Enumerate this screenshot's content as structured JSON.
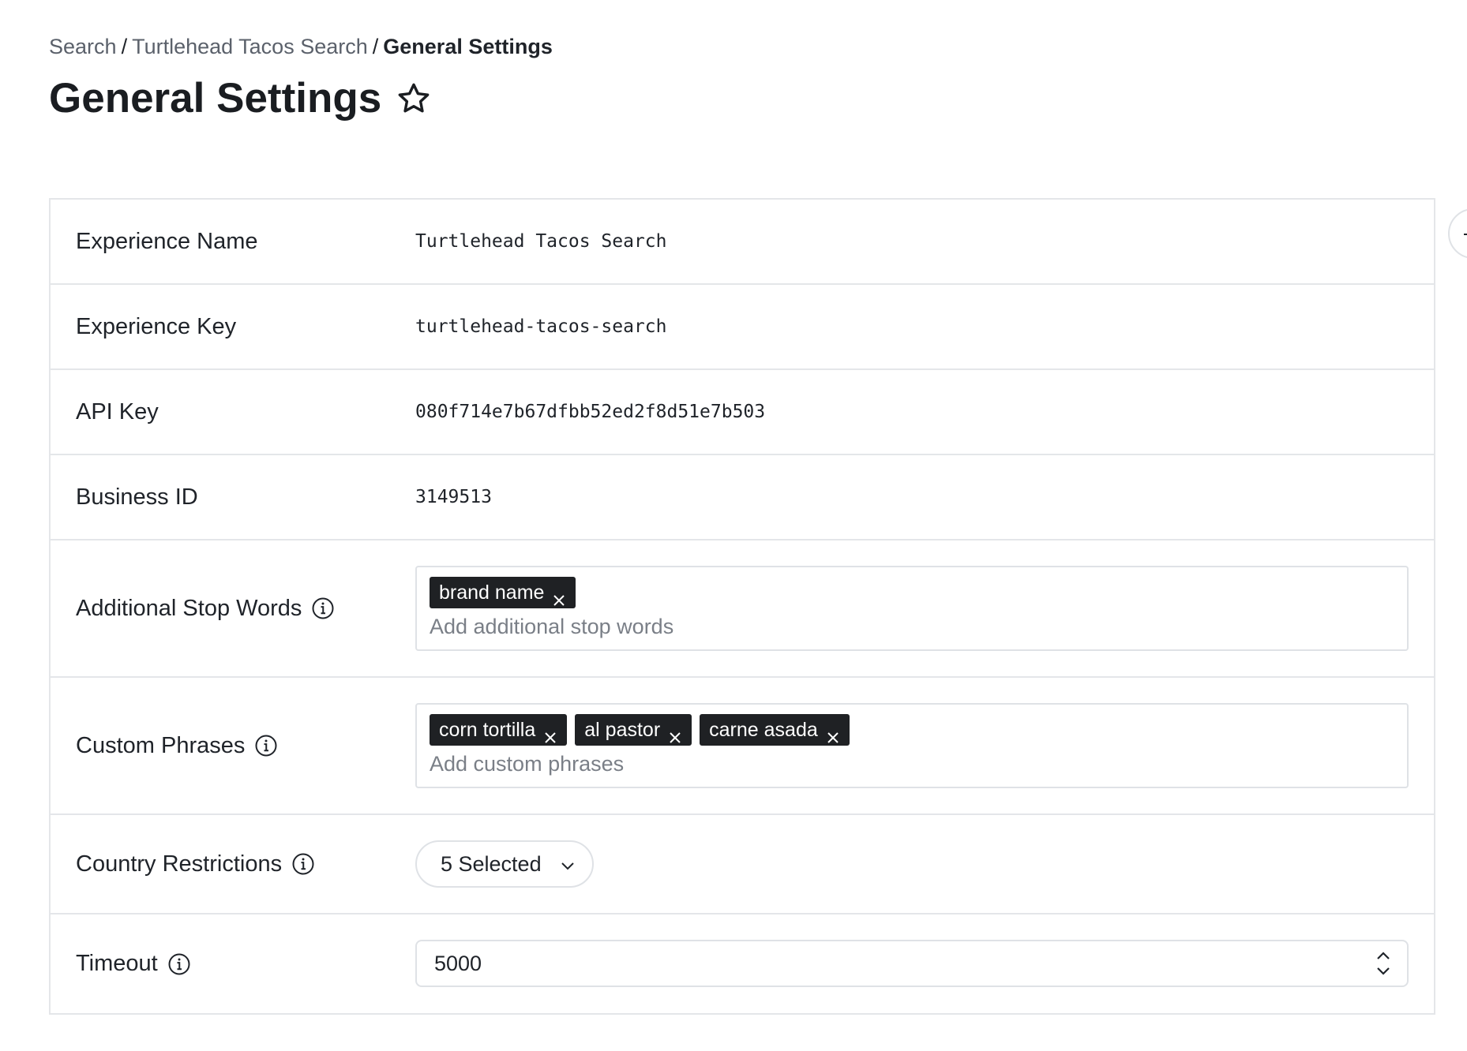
{
  "breadcrumb": {
    "items": [
      "Search",
      "Turtlehead Tacos Search"
    ],
    "current": "General Settings",
    "separator": "/"
  },
  "page": {
    "title": "General Settings",
    "favorite_icon": "star-icon"
  },
  "settings": {
    "experience_name": {
      "label": "Experience Name",
      "value": "Turtlehead Tacos Search"
    },
    "experience_key": {
      "label": "Experience Key",
      "value": "turtlehead-tacos-search"
    },
    "api_key": {
      "label": "API Key",
      "value": "080f714e7b67dfbb52ed2f8d51e7b503"
    },
    "business_id": {
      "label": "Business ID",
      "value": "3149513"
    },
    "stop_words": {
      "label": "Additional Stop Words",
      "tags": [
        "brand name"
      ],
      "placeholder": "Add additional stop words"
    },
    "custom_phrases": {
      "label": "Custom Phrases",
      "tags": [
        "corn tortilla",
        "al pastor",
        "carne asada"
      ],
      "placeholder": "Add custom phrases"
    },
    "country_restrictions": {
      "label": "Country Restrictions",
      "selected": "5 Selected"
    },
    "timeout": {
      "label": "Timeout",
      "value": "5000"
    }
  },
  "colors": {
    "tag_bg": "#1f2124",
    "border": "#e4e6e9",
    "text": "#1f2329",
    "muted": "#5b616b"
  }
}
